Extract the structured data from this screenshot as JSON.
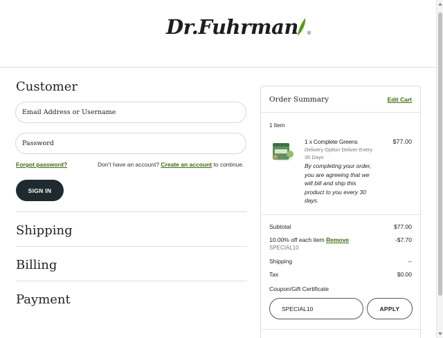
{
  "header": {
    "logo_text": "Dr.Fuhrman",
    "logo_reg": "®"
  },
  "customer": {
    "title": "Customer",
    "email_placeholder": "Email Address or Username",
    "password_placeholder": "Password",
    "forgot_password": "Forgot password?",
    "no_account_prefix": "Don't have an account?",
    "create_account": "Create an account",
    "no_account_suffix": "to continue.",
    "signin_label": "SIGN IN"
  },
  "sections": {
    "shipping": "Shipping",
    "billing": "Billing",
    "payment": "Payment"
  },
  "summary": {
    "title": "Order Summary",
    "edit_cart": "Edit Cart",
    "items_count": "1 Item",
    "product": {
      "name": "1 x Complete Greens",
      "delivery": "Delivery Option Deliver Every 30 Days",
      "note": "By completing your order, you are agreeing that we will bill and ship this product to you every 30 days.",
      "price": "$77.00"
    },
    "subtotal_label": "Subtotal",
    "subtotal_value": "$77.00",
    "discount_label": "10.00% off each item",
    "discount_remove": "Remove",
    "discount_value": "-$7.70",
    "discount_code": "SPECIAL10",
    "shipping_label": "Shipping",
    "shipping_value": "--",
    "tax_label": "Tax",
    "tax_value": "$0.00",
    "coupon_label": "Coupon/Gift Certificate",
    "coupon_value": "SPECIAL10",
    "apply_label": "APPLY"
  },
  "colors": {
    "accent_green": "#3e6a12",
    "button_dark": "#1f2a2f"
  }
}
